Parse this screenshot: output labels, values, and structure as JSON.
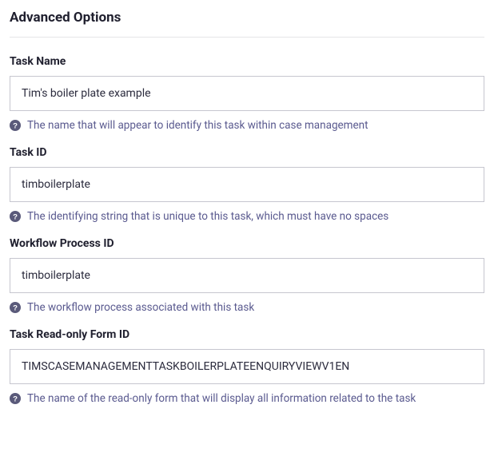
{
  "section": {
    "title": "Advanced Options"
  },
  "fields": {
    "task_name": {
      "label": "Task Name",
      "value": "Tim's boiler plate example",
      "help": "The name that will appear to identify this task within case management"
    },
    "task_id": {
      "label": "Task ID",
      "value": "timboilerplate",
      "help": "The identifying string that is unique to this task, which must have no spaces"
    },
    "workflow_process_id": {
      "label": "Workflow Process ID",
      "value": "timboilerplate",
      "help": "The workflow process associated with this task"
    },
    "task_readonly_form_id": {
      "label": "Task Read-only Form ID",
      "value": "TIMSCASEMANAGEMENTTASKBOILERPLATEENQUIRYVIEWV1EN",
      "help": "The name of the read-only form that will display all information related to the task"
    }
  }
}
